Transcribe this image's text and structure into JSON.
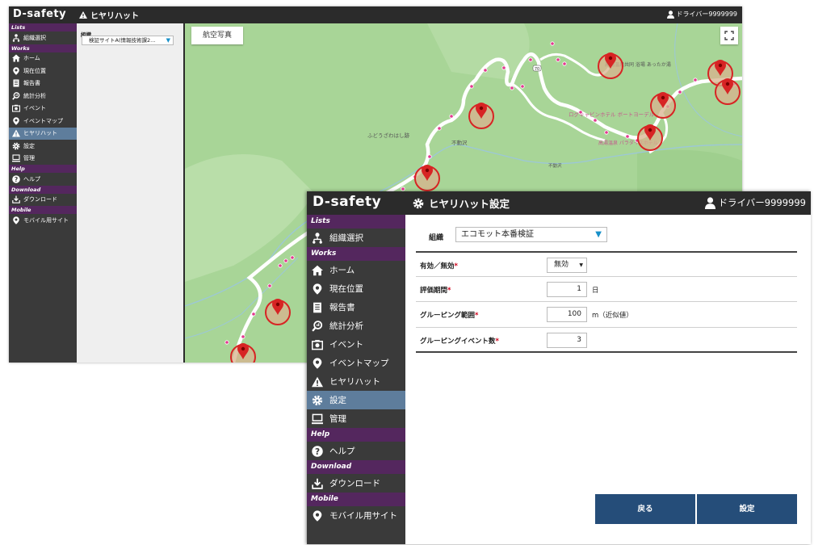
{
  "app": {
    "logo": "D-safety",
    "user_name": "ドライバー9999999"
  },
  "nav": {
    "sections": {
      "lists": "Lists",
      "works": "Works",
      "help": "Help",
      "download": "Download",
      "mobile": "Mobile"
    },
    "items": {
      "org_select": "組織選択",
      "home": "ホーム",
      "current_location": "現在位置",
      "reports": "報告書",
      "statistics": "統計分析",
      "events": "イベント",
      "event_map": "イベントマップ",
      "hiyari_hatto": "ヒヤリハット",
      "settings": "設定",
      "admin": "管理",
      "help": "ヘルプ",
      "download": "ダウンロード",
      "mobile_site": "モバイル用サイト"
    }
  },
  "back_window": {
    "title": "ヒヤリハット",
    "active_item": "hiyari_hatto",
    "org_label": "組織",
    "org_value": "検証サイトA(情報技術課2…",
    "map_type_button": "航空写真",
    "map_labels": {
      "onsen": "高湯温泉共同\n浴場 あったか湯",
      "hotel": "ログキャビンホテル\nボートヨーデル",
      "spot1": "ふどうざわはし跡",
      "spot2": "不動沢",
      "spot3": "不動沢",
      "spot4": "高湯温泉\nパラダイスホテル",
      "road": "70"
    }
  },
  "front_window": {
    "title": "ヒヤリハット設定",
    "active_item": "settings",
    "org_label": "組織",
    "org_value": "エコモット本番検証",
    "fields": [
      {
        "label": "有効／無効",
        "required": "*",
        "type": "select",
        "value": "無効",
        "unit": ""
      },
      {
        "label": "評価期間",
        "required": "*",
        "type": "number",
        "value": "1",
        "unit": "日"
      },
      {
        "label": "グルーピング範囲",
        "required": "*",
        "type": "number",
        "value": "100",
        "unit": "m（近似値）"
      },
      {
        "label": "グルーピングイベント数",
        "required": "*",
        "type": "number",
        "value": "3",
        "unit": ""
      }
    ],
    "buttons": {
      "back": "戻る",
      "set": "設定"
    }
  },
  "colors": {
    "header_bg": "#2b2b2b",
    "sidebar_bg": "#3a3a3a",
    "section_bg": "#54275e",
    "active_bg": "#5e7d9c",
    "button_bg": "#254d79",
    "map_green": "#a8d597",
    "marker_red": "#d72424",
    "point_pink": "#e3398f",
    "select_arrow": "#1890c9"
  },
  "icons": {
    "warning": "warning-icon",
    "user": "user-icon",
    "org": "org-tree-icon",
    "home": "home-icon",
    "pin": "map-pin-icon",
    "report": "report-icon",
    "stats": "search-chart-icon",
    "event": "camera-icon",
    "gear": "gear-icon",
    "monitor": "monitor-icon",
    "help": "question-icon",
    "download": "download-icon",
    "fullscreen": "fullscreen-icon"
  }
}
